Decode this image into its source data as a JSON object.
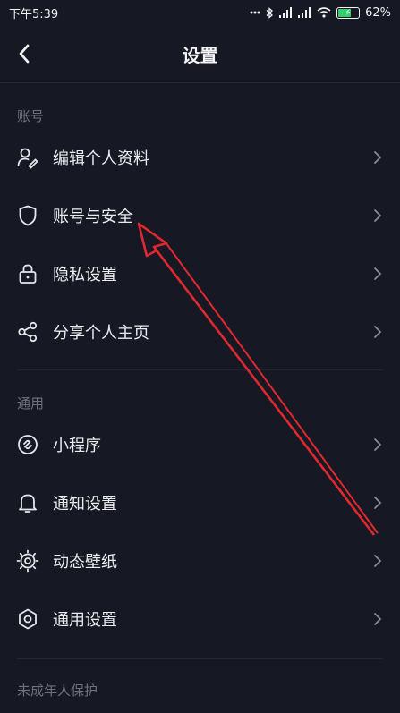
{
  "status_bar": {
    "time": "下午5:39",
    "battery_percent": "62%",
    "icons": [
      "more-dots-icon",
      "bluetooth-icon",
      "signal-icon",
      "signal-icon",
      "wifi-icon",
      "battery-icon"
    ]
  },
  "header": {
    "title": "设置",
    "back_icon": "chevron-left-icon"
  },
  "sections": [
    {
      "label": "账号",
      "items": [
        {
          "label": "编辑个人资料",
          "icon": "edit-profile-icon"
        },
        {
          "label": "账号与安全",
          "icon": "shield-icon"
        },
        {
          "label": "隐私设置",
          "icon": "lock-icon"
        },
        {
          "label": "分享个人主页",
          "icon": "share-icon"
        }
      ]
    },
    {
      "label": "通用",
      "items": [
        {
          "label": "小程序",
          "icon": "mini-program-icon"
        },
        {
          "label": "通知设置",
          "icon": "bell-icon"
        },
        {
          "label": "动态壁纸",
          "icon": "live-wallpaper-icon"
        },
        {
          "label": "通用设置",
          "icon": "hexagon-gear-icon"
        }
      ]
    },
    {
      "label": "未成年人保护",
      "items": []
    }
  ],
  "colors": {
    "background": "#161823",
    "text": "#ebebef",
    "muted": "#6f717c",
    "annotation_arrow": "#e0282f"
  }
}
